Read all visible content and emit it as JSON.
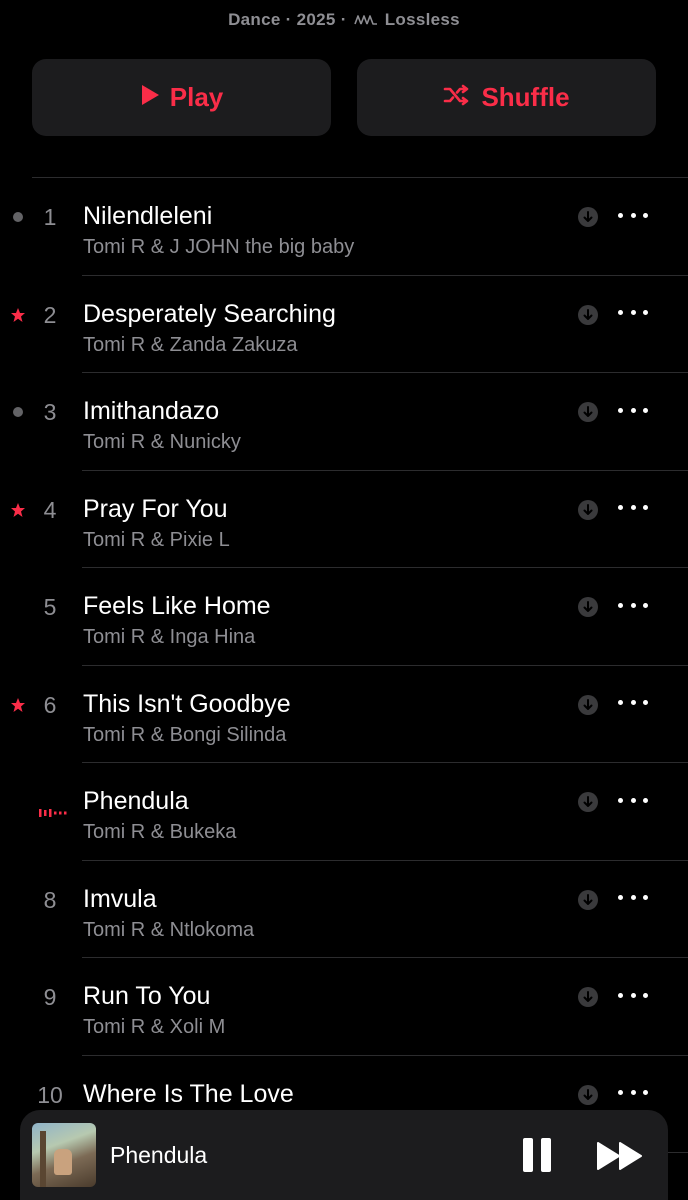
{
  "header": {
    "genre": "Dance",
    "year": "2025",
    "quality": "Lossless"
  },
  "actions": {
    "play_label": "Play",
    "shuffle_label": "Shuffle"
  },
  "colors": {
    "accent": "#fa2d48",
    "background": "#000000",
    "secondary_text": "#8e8e93"
  },
  "tracks": [
    {
      "number": "1",
      "title": "Nilendleleni",
      "artist": "Tomi R & J JOHN the big baby",
      "marker": "dot"
    },
    {
      "number": "2",
      "title": "Desperately Searching",
      "artist": "Tomi R & Zanda Zakuza",
      "marker": "star"
    },
    {
      "number": "3",
      "title": "Imithandazo",
      "artist": "Tomi R & Nunicky",
      "marker": "dot"
    },
    {
      "number": "4",
      "title": "Pray For You",
      "artist": "Tomi R & Pixie L",
      "marker": "star"
    },
    {
      "number": "5",
      "title": "Feels Like Home",
      "artist": "Tomi R & Inga Hina",
      "marker": "none"
    },
    {
      "number": "6",
      "title": "This Isn't Goodbye",
      "artist": "Tomi R & Bongi Silinda",
      "marker": "star"
    },
    {
      "number": "",
      "title": "Phendula",
      "artist": "Tomi R & Bukeka",
      "marker": "now-playing"
    },
    {
      "number": "8",
      "title": "Imvula",
      "artist": "Tomi R & Ntlokoma",
      "marker": "none"
    },
    {
      "number": "9",
      "title": "Run To You",
      "artist": "Tomi R & Xoli M",
      "marker": "none"
    },
    {
      "number": "10",
      "title": "Where Is The Love",
      "artist": "",
      "marker": "none"
    }
  ],
  "mini_player": {
    "title": "Phendula",
    "state": "playing"
  }
}
